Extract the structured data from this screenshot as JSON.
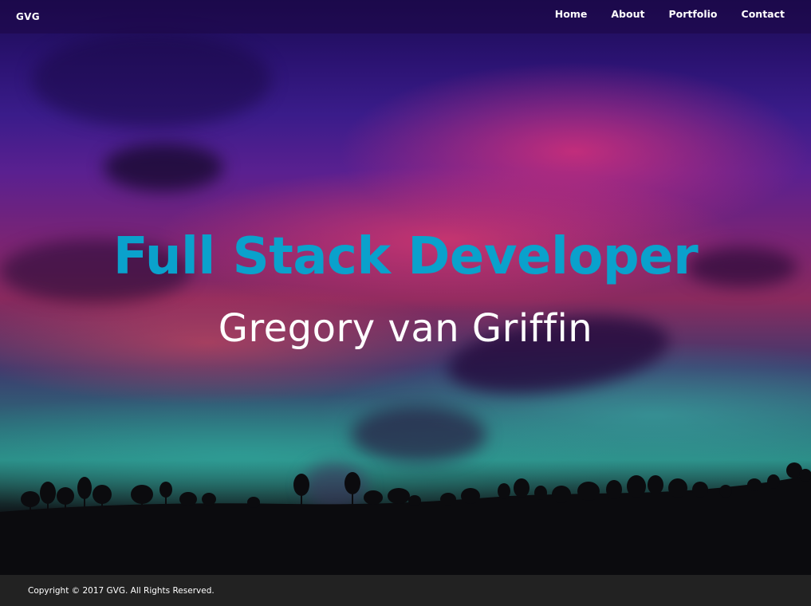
{
  "navbar": {
    "brand": "GVG",
    "links": [
      {
        "label": "Home"
      },
      {
        "label": "About"
      },
      {
        "label": "Portfolio"
      },
      {
        "label": "Contact"
      }
    ]
  },
  "hero": {
    "title": "Full Stack Developer",
    "subtitle": "Gregory van Griffin",
    "title_color": "#0aa1cc",
    "subtitle_color": "#ffffff"
  },
  "footer": {
    "copyright": "Copyright © 2017 GVG. All Rights Reserved.",
    "background": "#222222"
  }
}
